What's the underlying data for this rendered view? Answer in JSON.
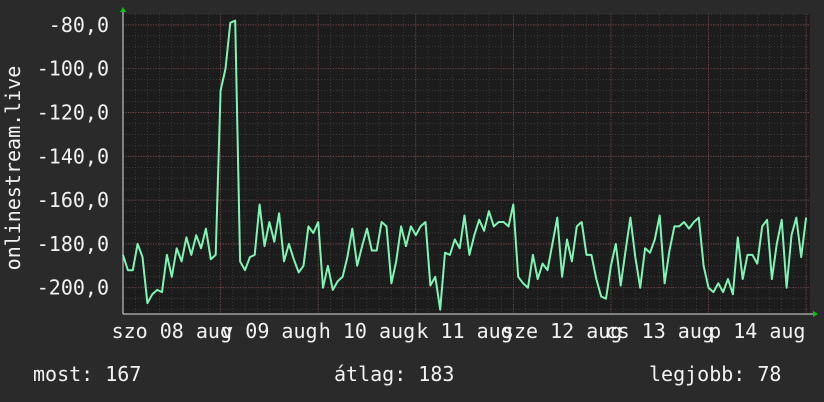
{
  "chart_data": {
    "type": "line",
    "ylabel": "onlinestream.live",
    "ylim": [
      -212,
      -75
    ],
    "yticks": [
      -80,
      -100,
      -120,
      -140,
      -160,
      -180,
      -200
    ],
    "ytick_labels": [
      "-80,0",
      "-100,0",
      "-120,0",
      "-140,0",
      "-160,0",
      "-180,0",
      "-200,0"
    ],
    "xlim": [
      0,
      7.04
    ],
    "xticks": [
      0.5,
      1.5,
      2.5,
      3.5,
      4.5,
      5.5,
      6.5
    ],
    "xtick_labels": [
      "szo 08 aug",
      "v 09 aug",
      "h 10 aug",
      "k 11 aug",
      "sze 12 aug",
      "cs 13 aug",
      "p 14 aug"
    ],
    "grid": true,
    "series": [
      {
        "color": "#7ff5b4",
        "x": [
          0.0,
          0.05,
          0.1,
          0.15,
          0.2,
          0.25,
          0.3,
          0.35,
          0.4,
          0.45,
          0.5,
          0.55,
          0.6,
          0.65,
          0.7,
          0.75,
          0.8,
          0.85,
          0.9,
          0.95,
          1.0,
          1.05,
          1.1,
          1.15,
          1.2,
          1.25,
          1.3,
          1.35,
          1.4,
          1.45,
          1.5,
          1.55,
          1.6,
          1.65,
          1.7,
          1.75,
          1.8,
          1.85,
          1.9,
          1.95,
          2.0,
          2.05,
          2.1,
          2.15,
          2.2,
          2.25,
          2.3,
          2.35,
          2.4,
          2.45,
          2.5,
          2.55,
          2.6,
          2.65,
          2.7,
          2.75,
          2.8,
          2.85,
          2.9,
          2.95,
          3.0,
          3.05,
          3.1,
          3.15,
          3.2,
          3.25,
          3.3,
          3.35,
          3.4,
          3.45,
          3.5,
          3.55,
          3.6,
          3.65,
          3.7,
          3.75,
          3.8,
          3.85,
          3.9,
          3.95,
          4.0,
          4.05,
          4.1,
          4.15,
          4.2,
          4.25,
          4.3,
          4.35,
          4.4,
          4.45,
          4.5,
          4.55,
          4.6,
          4.65,
          4.7,
          4.75,
          4.8,
          4.85,
          4.9,
          4.95,
          5.0,
          5.05,
          5.1,
          5.15,
          5.2,
          5.25,
          5.3,
          5.35,
          5.4,
          5.45,
          5.5,
          5.55,
          5.6,
          5.65,
          5.7,
          5.75,
          5.8,
          5.85,
          5.9,
          5.95,
          6.0,
          6.05,
          6.1,
          6.15,
          6.2,
          6.25,
          6.3,
          6.35,
          6.4,
          6.45,
          6.5,
          6.55,
          6.6,
          6.65,
          6.7,
          6.75,
          6.8,
          6.85,
          6.9,
          6.95,
          7.0
        ],
        "y": [
          -185,
          -192,
          -192,
          -180,
          -186,
          -207,
          -203,
          -201,
          -202,
          -185,
          -195,
          -182,
          -188,
          -177,
          -185,
          -176,
          -182,
          -173,
          -187,
          -185,
          -110,
          -100,
          -79,
          -78,
          -188,
          -192,
          -186,
          -185,
          -162,
          -181,
          -170,
          -179,
          -166,
          -188,
          -180,
          -187,
          -193,
          -190,
          -172,
          -175,
          -170,
          -200,
          -190,
          -201,
          -197,
          -195,
          -186,
          -173,
          -190,
          -181,
          -173,
          -183,
          -183,
          -170,
          -172,
          -198,
          -188,
          -172,
          -181,
          -172,
          -176,
          -172,
          -170,
          -199,
          -195,
          -210,
          -184,
          -185,
          -178,
          -182,
          -167,
          -185,
          -176,
          -169,
          -174,
          -165,
          -172,
          -170,
          -170,
          -172,
          -162,
          -195,
          -198,
          -200,
          -185,
          -196,
          -189,
          -192,
          -180,
          -168,
          -195,
          -178,
          -188,
          -172,
          -170,
          -185,
          -185,
          -196,
          -204,
          -205,
          -190,
          -180,
          -199,
          -183,
          -168,
          -186,
          -200,
          -182,
          -184,
          -178,
          -167,
          -198,
          -183,
          -172,
          -172,
          -170,
          -173,
          -170,
          -168,
          -190,
          -200,
          -202,
          -198,
          -202,
          -196,
          -203,
          -177,
          -196,
          -185,
          -185,
          -189,
          -172,
          -169,
          -196,
          -180,
          -169,
          -200,
          -176,
          -168,
          -186,
          -168
        ]
      }
    ]
  },
  "stats": {
    "current": "most: 167",
    "average": "átlag: 183",
    "best": "legjobb: 78"
  }
}
